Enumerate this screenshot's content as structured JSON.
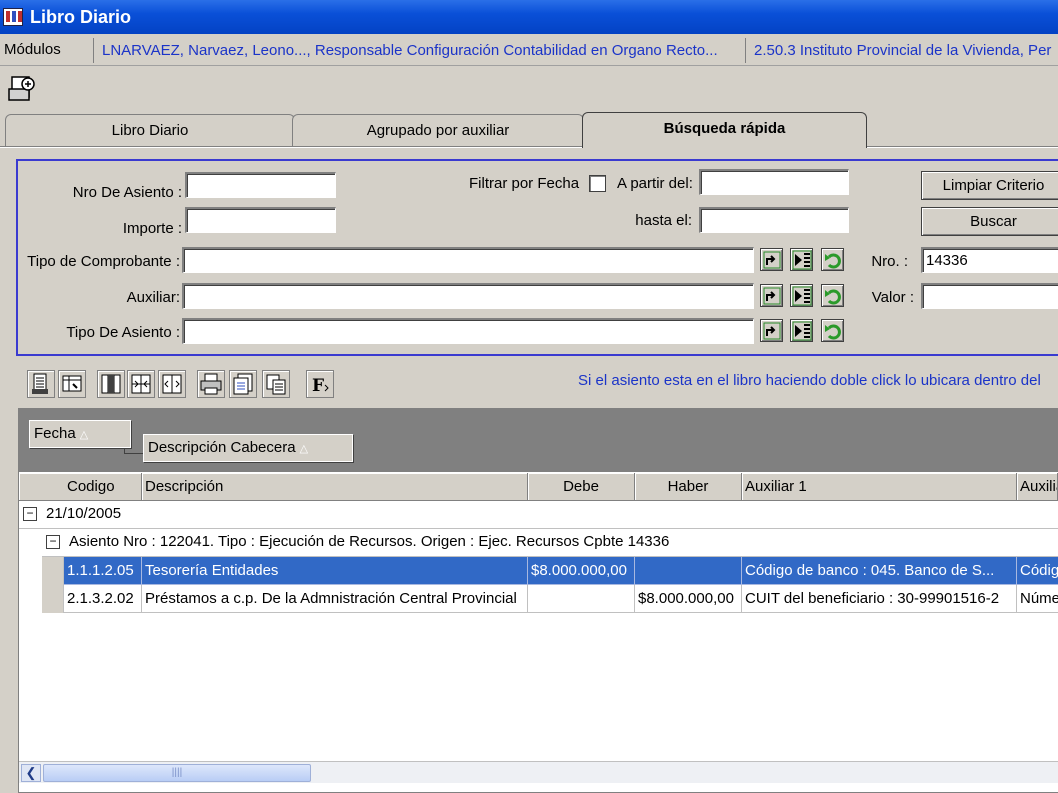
{
  "window": {
    "title": "Libro Diario"
  },
  "infobar": {
    "label": "Módulos",
    "user": "LNARVAEZ, Narvaez, Leono..., Responsable Configuración Contabilidad en Organo Recto...",
    "entity": "2.50.3 Instituto Provincial de la Vivienda, Per"
  },
  "tabs": [
    {
      "label": "Libro Diario"
    },
    {
      "label": "Agrupado por auxiliar"
    },
    {
      "label": "Búsqueda rápida"
    }
  ],
  "search": {
    "nro_asiento_label": "Nro De Asiento :",
    "nro_asiento_value": "",
    "importe_label": "Importe :",
    "importe_value": "",
    "filtrar_fecha_label": "Filtrar por Fecha",
    "filtrar_fecha_checked": false,
    "a_partir_label": "A partir del:",
    "a_partir_value": "",
    "hasta_label": "hasta el:",
    "hasta_value": "",
    "tipo_comprobante_label": "Tipo de Comprobante :",
    "tipo_comprobante_value": "",
    "auxiliar_label": "Auxiliar:",
    "auxiliar_value": "",
    "tipo_asiento_label": "Tipo De Asiento :",
    "tipo_asiento_value": "",
    "nro_label": "Nro. :",
    "nro_value": "14336",
    "valor_label": "Valor :",
    "valor_value": "",
    "limpiar_label": "Limpiar Criterio",
    "buscar_label": "Buscar"
  },
  "hint": "Si el asiento esta en el libro haciendo doble click lo ubicara dentro del",
  "group_by": [
    {
      "label": "Fecha"
    },
    {
      "label": "Descripción Cabecera"
    }
  ],
  "columns": [
    "Codigo",
    "Descripción",
    "Debe",
    "Haber",
    "Auxiliar 1",
    "Auxilia"
  ],
  "group_date": "21/10/2005",
  "group_asiento": "Asiento Nro : 122041. Tipo : Ejecución de Recursos. Origen : Ejec. Recursos Cpbte 14336",
  "rows": [
    {
      "codigo": "1.1.1.2.05",
      "descripcion": "Tesorería Entidades",
      "debe": "$8.000.000,00",
      "haber": "",
      "aux1": "Código de banco : 045. Banco de S...",
      "aux2": "Códig",
      "selected": true
    },
    {
      "codigo": "2.1.3.2.02",
      "descripcion": "Préstamos a c.p. De la Admnistración Central Provincial",
      "debe": "",
      "haber": "$8.000.000,00",
      "aux1": "CUIT del beneficiario : 30-99901516-2",
      "aux2": "Núme",
      "selected": false
    }
  ],
  "colors": {
    "title_bar": "#0a50d8",
    "selection": "#3169c6",
    "link_text": "#1b34c8"
  }
}
